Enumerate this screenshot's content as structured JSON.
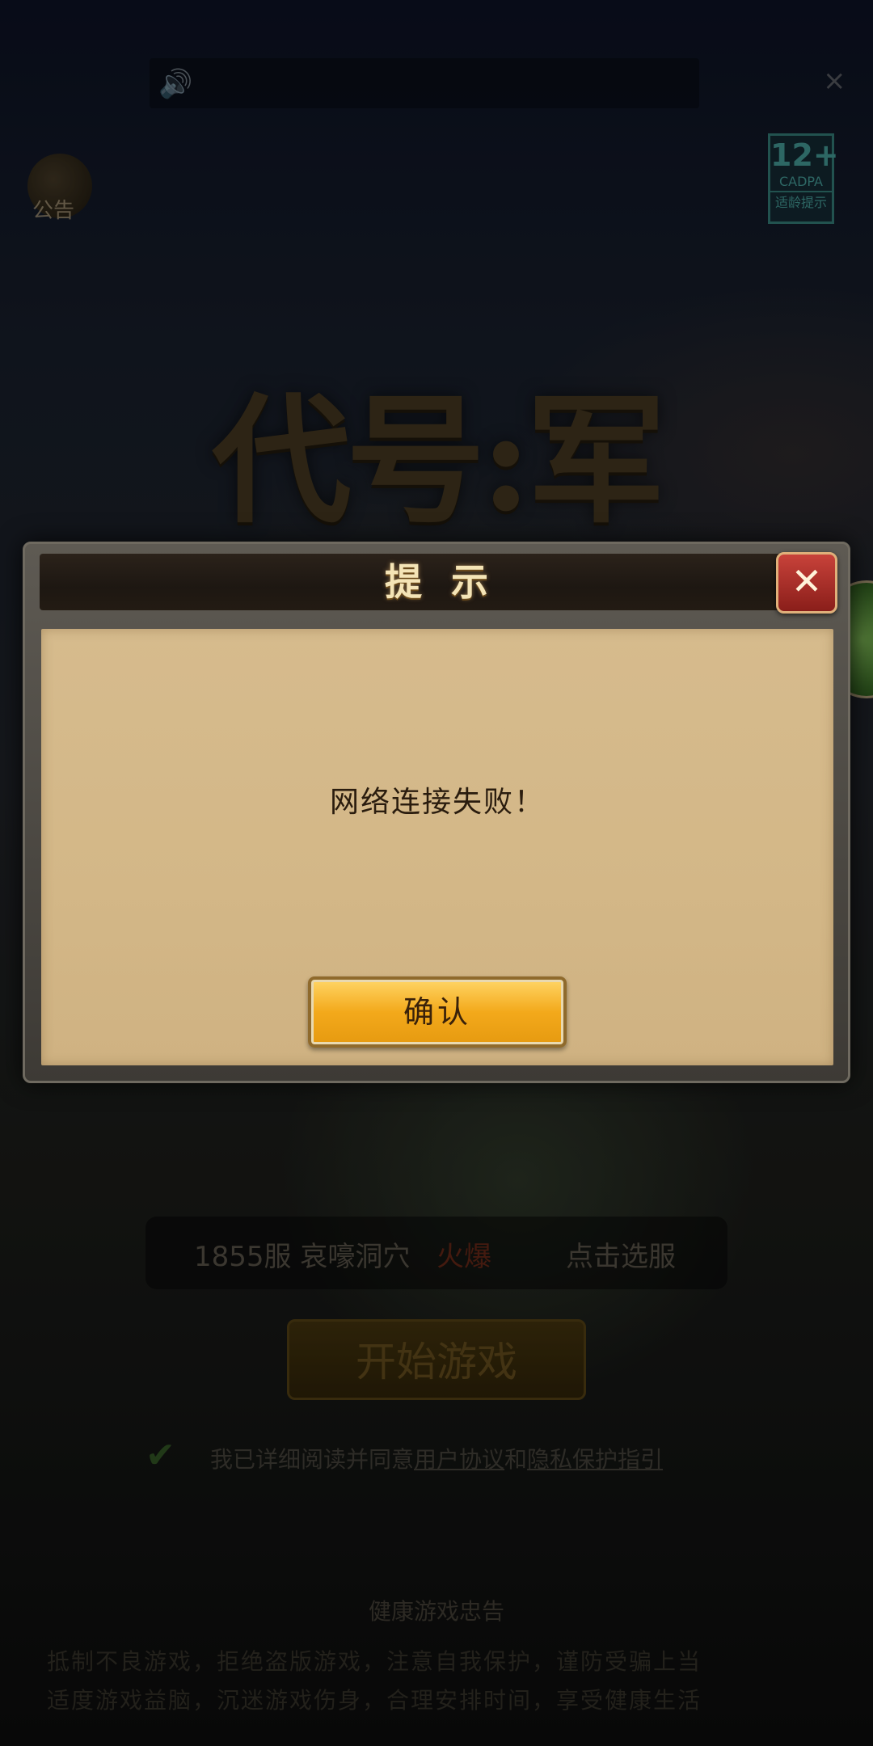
{
  "background": {
    "notice_label": "公告",
    "age_badge": {
      "rating": "12+",
      "org": "CADPA",
      "tip": "适龄提示"
    },
    "logo_text": "代号:军团",
    "server": {
      "name": "1855服 哀嚎洞穴",
      "status": "火爆",
      "select_label": "点击选服"
    },
    "start_button": "开始游戏",
    "agreement": {
      "prefix": "我已详细阅读并同意",
      "user_agreement": "用户协议",
      "and": "和",
      "privacy_guide": "隐私保护指引"
    },
    "health_title": "健康游戏忠告",
    "health_line1": "抵制不良游戏，拒绝盗版游戏，注意自我保护，谨防受骗上当",
    "health_line2": "适度游戏益脑，沉迷游戏伤身，合理安排时间，享受健康生活"
  },
  "dialog": {
    "title": "提示",
    "close_glyph": "✕",
    "message": "网络连接失败！",
    "confirm_label": "确认"
  },
  "colors": {
    "accent_gold": "#f3a91b",
    "parchment": "#d6bb8d",
    "close_red": "#c8423a"
  }
}
